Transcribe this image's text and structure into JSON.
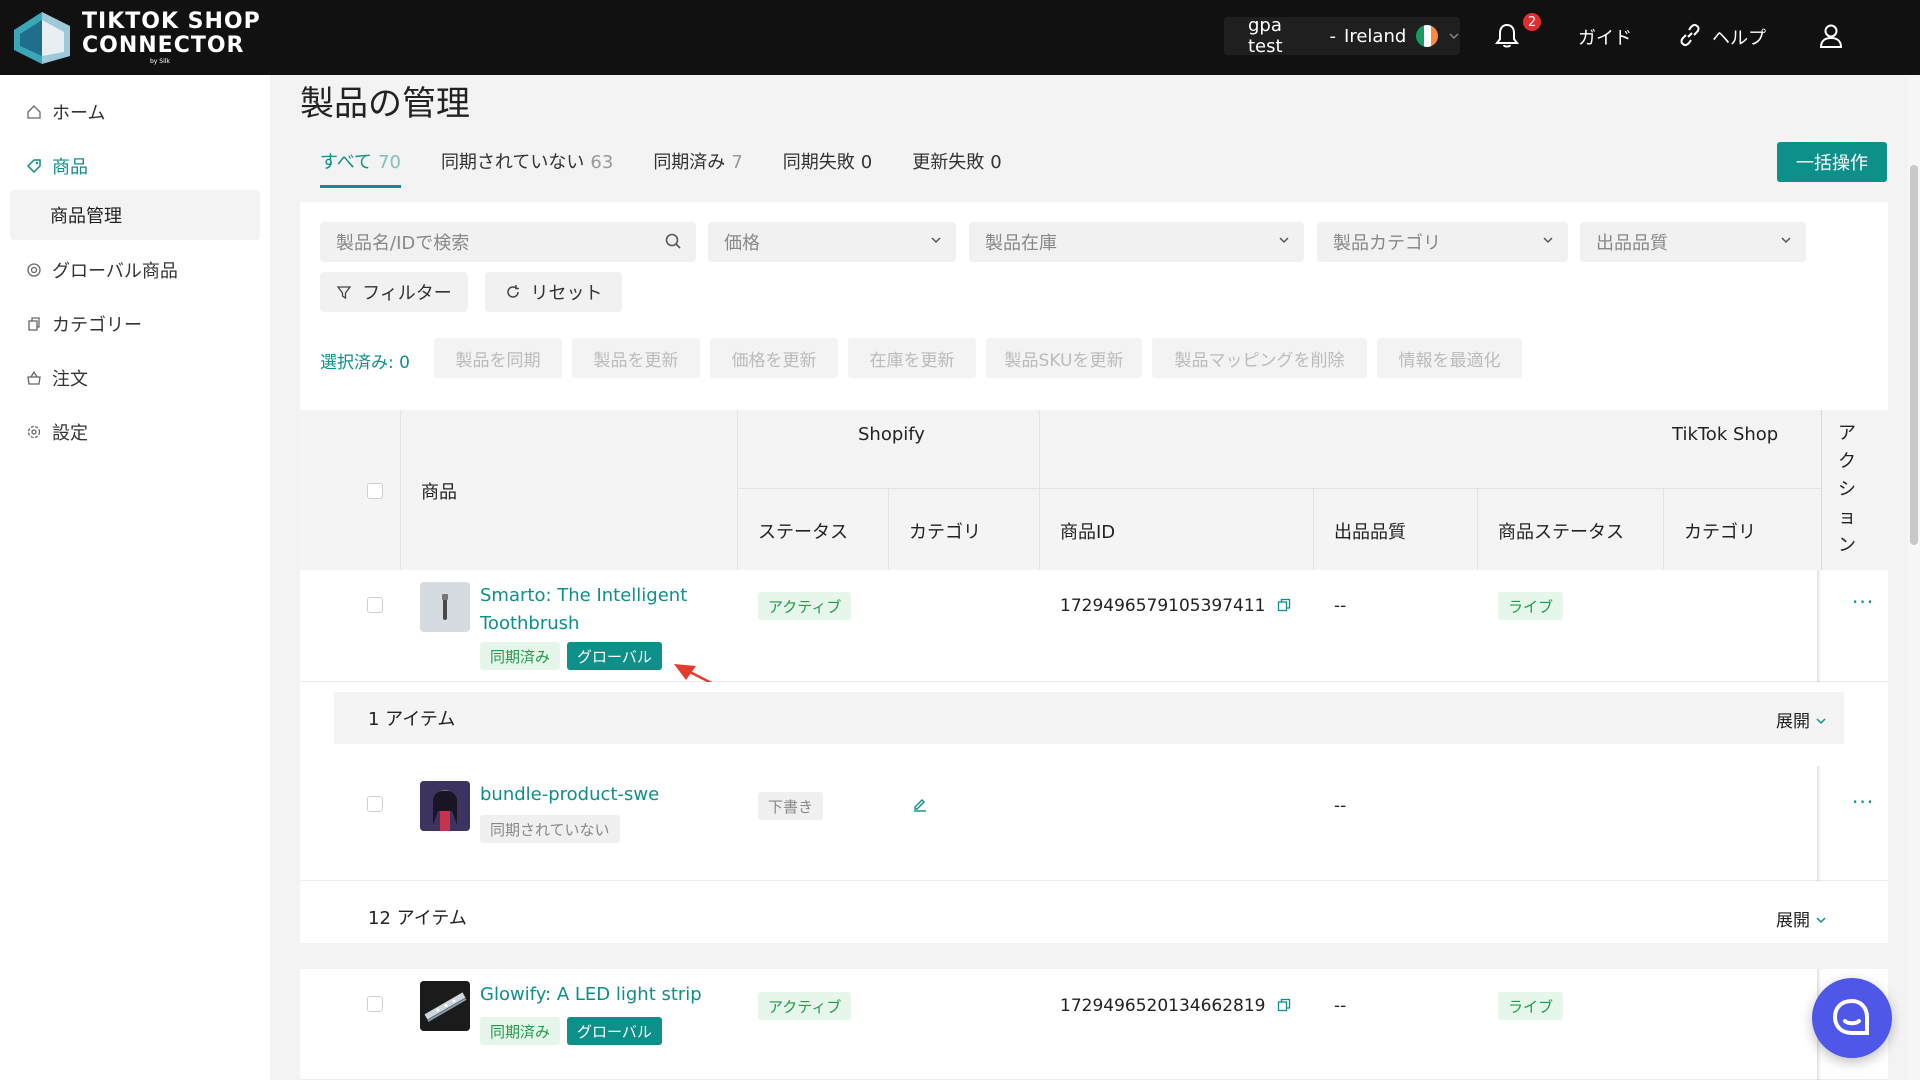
{
  "header": {
    "logo_line1": "TIKTOK SHOP",
    "logo_line2": "CONNECTOR",
    "logo_by": "by Silk",
    "store_name": "gpa test",
    "store_sep": "-",
    "store_region": "Ireland",
    "notification_count": "2",
    "guide_label": "ガイド",
    "help_label": "ヘルプ"
  },
  "sidebar": {
    "items": [
      {
        "label": "ホーム",
        "icon": "home-icon"
      },
      {
        "label": "商品",
        "icon": "tag-icon"
      },
      {
        "label": "グローバル商品",
        "icon": "globe-icon"
      },
      {
        "label": "カテゴリー",
        "icon": "copy-icon"
      },
      {
        "label": "注文",
        "icon": "cart-icon"
      },
      {
        "label": "設定",
        "icon": "gear-icon"
      }
    ],
    "sub_item": "商品管理"
  },
  "page": {
    "title": "製品の管理",
    "tabs": [
      {
        "label": "すべて",
        "count": "70"
      },
      {
        "label": "同期されていない",
        "count": "63"
      },
      {
        "label": "同期済み",
        "count": "7"
      },
      {
        "label": "同期失敗",
        "count": "0"
      },
      {
        "label": "更新失敗",
        "count": "0"
      }
    ],
    "bulk_button": "一括操作"
  },
  "filters": {
    "search_placeholder": "製品名/IDで検索",
    "price": "価格",
    "stock": "製品在庫",
    "category": "製品カテゴリ",
    "quality": "出品品質",
    "filter_button": "フィルター",
    "reset_button": "リセット"
  },
  "actions": {
    "selected": "選択済み: 0",
    "buttons": [
      "製品を同期",
      "製品を更新",
      "価格を更新",
      "在庫を更新",
      "製品SKUを更新",
      "製品マッピングを削除",
      "情報を最適化"
    ]
  },
  "table": {
    "col_product": "商品",
    "group_shopify": "Shopify",
    "group_tiktok": "TikTok Shop",
    "col_action": "アクション",
    "col_status": "ステータス",
    "col_category": "カテゴリ",
    "col_product_id": "商品ID",
    "col_quality": "出品品質",
    "col_product_status": "商品ステータス",
    "col_tt_category": "カテゴリ",
    "rows": [
      {
        "name_line1": "Smarto: The Intelligent",
        "name_line2": "Toothbrush",
        "tags": [
          "同期済み",
          "グローバル"
        ],
        "shopify_status": "アクティブ",
        "product_id": "1729496579105397411",
        "quality": "--",
        "tt_status": "ライブ",
        "more": "···"
      },
      {
        "name_line1": "bundle-product-swe",
        "tags": [
          "同期されていない"
        ],
        "shopify_status": "下書き",
        "quality": "--",
        "more": "···"
      },
      {
        "name_line1": "Glowify: A LED light strip",
        "tags": [
          "同期済み",
          "グローバル"
        ],
        "shopify_status": "アクティブ",
        "product_id": "1729496520134662819",
        "quality": "--",
        "tt_status": "ライブ"
      }
    ],
    "group1_label": "1 アイテム",
    "group2_label": "12 アイテム",
    "expand_label": "展開"
  },
  "colors": {
    "accent": "#0d8f8a",
    "header_bg": "#111111",
    "chat": "#4f57e8",
    "arrow": "#e33b2e"
  }
}
